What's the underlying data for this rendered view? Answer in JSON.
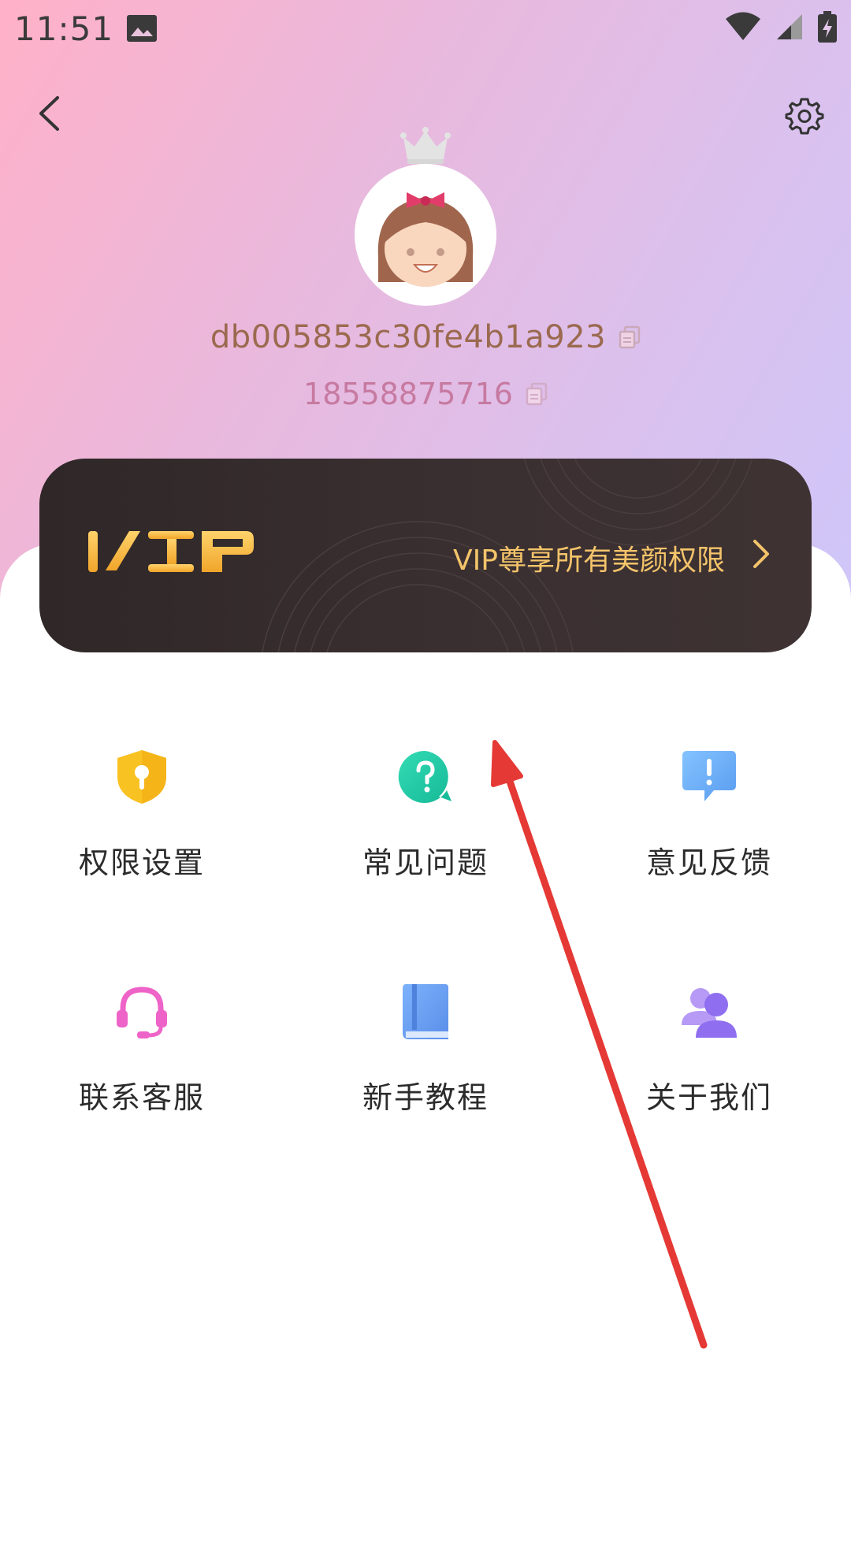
{
  "status_bar": {
    "time": "11:51",
    "icons": [
      "image-icon",
      "wifi-icon",
      "signal-icon",
      "battery-charging-icon"
    ]
  },
  "header": {
    "back_icon": "chevron-left-icon",
    "settings_icon": "gear-icon"
  },
  "profile": {
    "user_id": "db005853c30fe4b1a923",
    "phone": "18558875716",
    "avatar_icon": "girl-avatar-icon",
    "crown_icon": "crown-icon",
    "copy_icon": "copy-icon"
  },
  "vip_banner": {
    "logo_text": "VIP",
    "text": "VIP尊享所有美颜权限",
    "arrow_icon": "chevron-right-icon",
    "accent_color": "#f4c46a"
  },
  "menu": [
    {
      "label": "权限设置",
      "icon": "shield-key-icon",
      "color": "#f9c223"
    },
    {
      "label": "常见问题",
      "icon": "question-bubble-icon",
      "color": "#22cba6"
    },
    {
      "label": "意见反馈",
      "icon": "feedback-bubble-icon",
      "color": "#6aaef7"
    },
    {
      "label": "联系客服",
      "icon": "headset-icon",
      "color": "#ee63c7"
    },
    {
      "label": "新手教程",
      "icon": "book-icon",
      "color": "#6b9ff0"
    },
    {
      "label": "关于我们",
      "icon": "users-icon",
      "color": "#9a79ef"
    }
  ],
  "annotation": {
    "arrow_color": "#e53935"
  }
}
